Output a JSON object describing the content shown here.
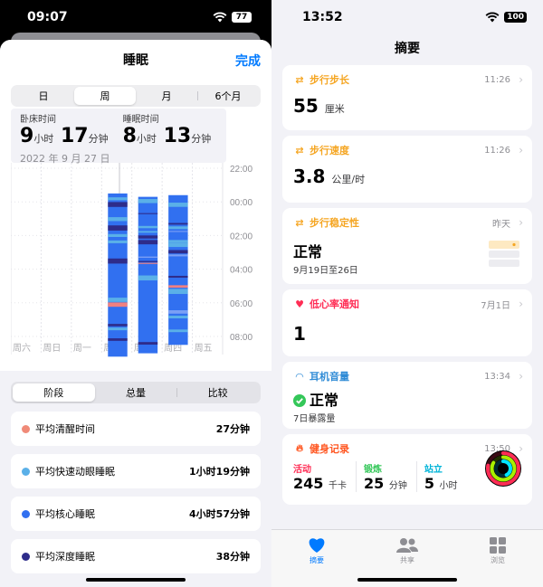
{
  "left": {
    "status_time": "09:07",
    "battery": "77",
    "sheet_title": "睡眠",
    "done_label": "完成",
    "range_tabs": [
      "日",
      "周",
      "月",
      "6个月"
    ],
    "range_active": 1,
    "in_bed_label": "卧床时间",
    "in_bed_h": "9",
    "in_bed_m": "17",
    "asleep_label": "睡眠时间",
    "asleep_h": "8",
    "asleep_m": "13",
    "unit_h": "小时",
    "unit_m": "分钟",
    "date": "2022 年 9 月 27 日",
    "chart_data": {
      "type": "bar",
      "categories": [
        "周六",
        "周日",
        "周一",
        "周二",
        "周三",
        "周四",
        "周五"
      ],
      "y_ticks": [
        "22:00",
        "00:00",
        "02:00",
        "04:00",
        "06:00",
        "08:00"
      ],
      "series": [
        {
          "values": [
            null,
            null,
            null,
            [
              23.5,
              33.2
            ],
            [
              23.7,
              33.0
            ],
            [
              23.6,
              32.5
            ],
            null
          ]
        }
      ],
      "colors": {
        "awake": "#f08080",
        "rem": "#5ab0e8",
        "core": "#3170f0",
        "deep": "#2e2c8a"
      }
    },
    "view_tabs": [
      "阶段",
      "总量",
      "比较"
    ],
    "view_active": 0,
    "stages": [
      {
        "name": "平均清醒时间",
        "value": "27分钟",
        "color": "#f08a78"
      },
      {
        "name": "平均快速动眼睡眠",
        "value": "1小时19分钟",
        "color": "#5ab0e8"
      },
      {
        "name": "平均核心睡眠",
        "value": "4小时57分钟",
        "color": "#3170f0"
      },
      {
        "name": "平均深度睡眠",
        "value": "38分钟",
        "color": "#2e2c8a"
      }
    ]
  },
  "right": {
    "status_time": "13:52",
    "battery": "100",
    "title": "摘要",
    "cards": [
      {
        "title": "步行步长",
        "time": "11:26",
        "value": "55",
        "unit": "厘米",
        "color": "#f5a623"
      },
      {
        "title": "步行速度",
        "time": "11:26",
        "value": "3.8",
        "unit": "公里/时",
        "color": "#f5a623"
      },
      {
        "title": "步行稳定性",
        "time": "昨天",
        "value": "正常",
        "sub": "9月19日至26日",
        "color": "#f5a623"
      },
      {
        "title": "低心率通知",
        "time": "7月1日",
        "value": "1",
        "color": "#ff2d55"
      },
      {
        "title": "耳机音量",
        "time": "13:34",
        "value": "正常",
        "sub": "7日暴露量",
        "color": "#2f8bd6"
      }
    ],
    "fitness": {
      "title": "健身记录",
      "time": "13:50",
      "color": "#ff5722",
      "cols": [
        {
          "label": "活动",
          "value": "245",
          "unit": "千卡",
          "color": "#ff2d55"
        },
        {
          "label": "锻炼",
          "value": "25",
          "unit": "分钟",
          "color": "#34c759"
        },
        {
          "label": "站立",
          "value": "5",
          "unit": "小时",
          "color": "#00b4d8"
        }
      ],
      "rings": {
        "move": 0.78,
        "exercise": 0.83,
        "stand": 0.42
      }
    },
    "tabbar": [
      {
        "label": "摘要",
        "icon": "heart-icon"
      },
      {
        "label": "共享",
        "icon": "people-icon"
      },
      {
        "label": "浏览",
        "icon": "grid-icon"
      }
    ]
  }
}
